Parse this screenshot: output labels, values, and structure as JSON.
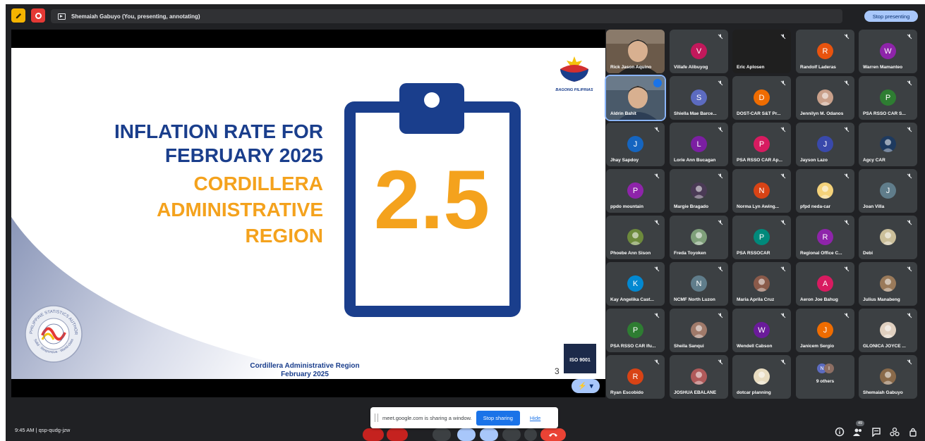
{
  "topbar": {
    "presenting_text": "Shemaiah Gabuyo (You, presenting, annotating)",
    "stop_presenting_label": "Stop presenting"
  },
  "slide": {
    "title_line1": "INFLATION RATE FOR",
    "title_line2": "FEBRUARY 2025",
    "region_line1": "CORDILLERA",
    "region_line2": "ADMINISTRATIVE",
    "region_line3": "REGION",
    "big_value": "2.5",
    "logo_text": "BAGONG PILIPINAS",
    "footer_line1": "Cordillera Administrative Region",
    "footer_line2": "February 2025",
    "page_number": "3",
    "iso_text": "ISO 9001",
    "seal_text": "PHILIPPINE STATISTICS AUTHORITY",
    "seal_motto": "Solid · Responsive · World-class"
  },
  "participants": [
    {
      "name": "Rick Jason Aquino",
      "type": "video"
    },
    {
      "name": "Villafe Alibuyog",
      "initial": "V",
      "color": "#c2185b"
    },
    {
      "name": "Eric Aplosen",
      "type": "dark"
    },
    {
      "name": "Randolf Laderas",
      "initial": "R",
      "color": "#e8530e"
    },
    {
      "name": "Warren Mamanteo",
      "initial": "W",
      "color": "#8e24aa"
    },
    {
      "name": "Aldrin Bahit",
      "type": "video2"
    },
    {
      "name": "Shiella Mae Barce...",
      "initial": "S",
      "color": "#5c6bc0"
    },
    {
      "name": "DOST-CAR S&T Pr...",
      "initial": "D",
      "color": "#ef6c00"
    },
    {
      "name": "Jennilyn M. Odanos",
      "type": "photo",
      "color": "#c9a08a"
    },
    {
      "name": "PSA RSSO CAR S...",
      "initial": "P",
      "color": "#2e7d32"
    },
    {
      "name": "Jhay Sapdoy",
      "initial": "J",
      "color": "#1565c0"
    },
    {
      "name": "Lorie Ann Bucagan",
      "initial": "L",
      "color": "#7b1fa2"
    },
    {
      "name": "PSA RSSO CAR Ap...",
      "initial": "P",
      "color": "#d81b60"
    },
    {
      "name": "Jayson Lazo",
      "initial": "J",
      "color": "#3949ab"
    },
    {
      "name": "Agcy CAR",
      "type": "photo",
      "color": "#1e3a5f"
    },
    {
      "name": "ppdo mountain",
      "initial": "P",
      "color": "#8e24aa"
    },
    {
      "name": "Margie Bragado",
      "type": "photo",
      "color": "#4a3a55"
    },
    {
      "name": "Norma Lyn Awing...",
      "initial": "N",
      "color": "#d84315"
    },
    {
      "name": "pfpd neda-car",
      "type": "photo",
      "color": "#f4d27a"
    },
    {
      "name": "Joan Villa",
      "initial": "J",
      "color": "#607d8b"
    },
    {
      "name": "Phoebe Ann Sison",
      "type": "photo",
      "color": "#6d8a3c"
    },
    {
      "name": "Freda Toyoken",
      "type": "photo",
      "color": "#7fa07a"
    },
    {
      "name": "PSA RSSOCAR",
      "initial": "P",
      "color": "#00897b"
    },
    {
      "name": "Regional Office C...",
      "initial": "R",
      "color": "#8e24aa"
    },
    {
      "name": "Debi",
      "type": "photo",
      "color": "#cbbf9a"
    },
    {
      "name": "Kay Angelika Cast...",
      "initial": "K",
      "color": "#0288d1"
    },
    {
      "name": "NCMF North Luzon",
      "initial": "N",
      "color": "#607d8b"
    },
    {
      "name": "Maria Aprila Cruz",
      "type": "photo",
      "color": "#8a5a4a"
    },
    {
      "name": "Aeron Joe Bahug",
      "initial": "A",
      "color": "#d81b60"
    },
    {
      "name": "Julius Manabeng",
      "type": "photo",
      "color": "#9a7a5a"
    },
    {
      "name": "PSA RSSO CAR Ifu...",
      "initial": "P",
      "color": "#2e7d32"
    },
    {
      "name": "Sheila Sanqui",
      "type": "photo",
      "color": "#a07a6a"
    },
    {
      "name": "Wendell Cabson",
      "initial": "W",
      "color": "#6a1b9a"
    },
    {
      "name": "Janicem Sergio",
      "initial": "J",
      "color": "#ef6c00"
    },
    {
      "name": "GLONICA JOYCE ...",
      "type": "photo",
      "color": "#e0d0c0"
    },
    {
      "name": "Ryan Escobido",
      "initial": "R",
      "color": "#d84315"
    },
    {
      "name": "JOSHUA EBALANE",
      "type": "photo",
      "color": "#b05a5a"
    },
    {
      "name": "dotcar planning",
      "type": "photo",
      "color": "#e8dcc0"
    },
    {
      "name": "9 others",
      "type": "others"
    },
    {
      "name": "Shemaiah Gabuyo",
      "type": "photo",
      "color": "#8a6a4a"
    }
  ],
  "others_avatars": [
    {
      "initial": "N",
      "color": "#5c6bc0"
    },
    {
      "initial": "I",
      "color": "#8d6e63"
    }
  ],
  "bottombar": {
    "time": "9:45 AM",
    "meeting_code": "qsp-qudg-jzw",
    "participant_count": "49"
  },
  "share_toast": {
    "message": "meet.google.com is sharing a window.",
    "stop_label": "Stop sharing",
    "hide_label": "Hide"
  }
}
